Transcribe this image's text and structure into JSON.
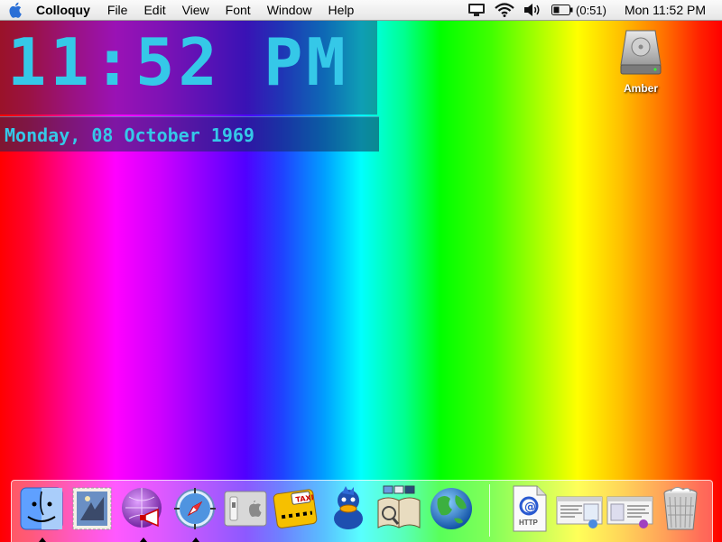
{
  "menubar": {
    "app_name": "Colloquy",
    "items": [
      "File",
      "Edit",
      "View",
      "Font",
      "Window",
      "Help"
    ],
    "battery_text": "(0:51)",
    "clock": "Mon 11:52 PM",
    "icons": [
      "apple-icon",
      "display-icon",
      "wifi-icon",
      "volume-icon",
      "battery-icon"
    ]
  },
  "widget": {
    "time": "11:52 PM",
    "date": "Monday, 08 October 1969",
    "color": "#35c8e8"
  },
  "desktop": {
    "icons": [
      {
        "label": "Amber",
        "icon": "hard-drive-icon"
      }
    ]
  },
  "dock": {
    "items": [
      {
        "name": "finder",
        "running": true
      },
      {
        "name": "mail",
        "running": false
      },
      {
        "name": "colloquy",
        "running": true
      },
      {
        "name": "safari",
        "running": true
      },
      {
        "name": "system-preferences",
        "running": false
      },
      {
        "name": "taxi-app",
        "running": false
      },
      {
        "name": "adium",
        "running": false
      },
      {
        "name": "dictionary",
        "running": false
      },
      {
        "name": "network-globe",
        "running": false
      },
      {
        "name": "http-document",
        "running": false
      },
      {
        "name": "minimized-window-1",
        "running": false
      },
      {
        "name": "minimized-window-2",
        "running": false
      },
      {
        "name": "trash",
        "running": false
      }
    ],
    "http_label": "HTTP"
  }
}
